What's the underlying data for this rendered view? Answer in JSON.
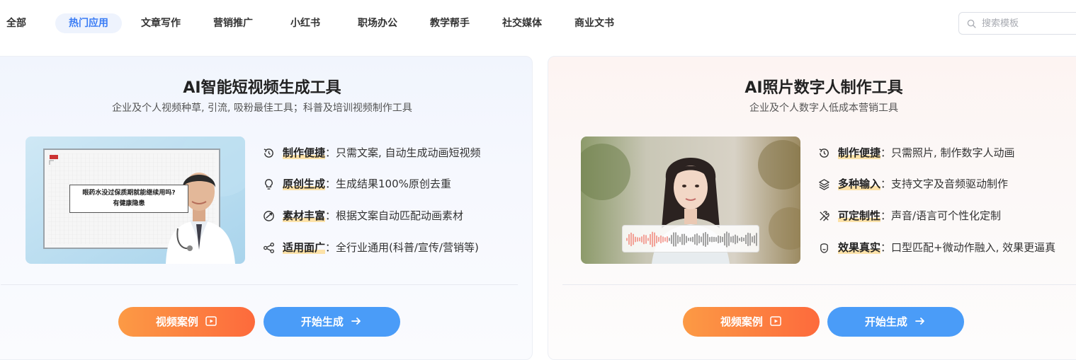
{
  "tabs": [
    {
      "label": "全部",
      "active": false
    },
    {
      "label": "热门应用",
      "active": true
    },
    {
      "label": "文章写作",
      "active": false
    },
    {
      "label": "营销推广",
      "active": false
    },
    {
      "label": "小红书",
      "active": false
    },
    {
      "label": "职场办公",
      "active": false
    },
    {
      "label": "教学帮手",
      "active": false
    },
    {
      "label": "社交媒体",
      "active": false
    },
    {
      "label": "商业文书",
      "active": false
    }
  ],
  "search": {
    "placeholder": "搜索模板",
    "icon": "search-icon"
  },
  "cards": [
    {
      "title": "AI智能短视频生成工具",
      "subtitle": "企业及个人视频种草, 引流, 吸粉最佳工具；科普及培训视频制作工具",
      "thumb": {
        "question_line1": "眼药水没过保质期就能继续用吗?",
        "question_line2": "有健康隐患"
      },
      "features": [
        {
          "icon": "clock-refresh-icon",
          "key": "制作便捷",
          "desc": "：只需文案, 自动生成动画短视频"
        },
        {
          "icon": "lightbulb-icon",
          "key": "原创生成",
          "desc": "：生成结果100%原创去重"
        },
        {
          "icon": "shuffle-icon",
          "key": "素材丰富",
          "desc": "：根据文案自动匹配动画素材"
        },
        {
          "icon": "share-icon",
          "key": "适用面广",
          "desc": "：全行业通用(科普/宣传/营销等)"
        }
      ],
      "buttons": {
        "cases": "视频案例",
        "start": "开始生成"
      }
    },
    {
      "title": "AI照片数字人制作工具",
      "subtitle": "企业及个人数字人低成本营销工具",
      "features": [
        {
          "icon": "clock-refresh-icon",
          "key": "制作便捷",
          "desc": "：只需照片, 制作数字人动画"
        },
        {
          "icon": "layers-icon",
          "key": "多种输入",
          "desc": "：支持文字及音频驱动制作"
        },
        {
          "icon": "tools-icon",
          "key": "可定制性",
          "desc": "：声音/语言可个性化定制"
        },
        {
          "icon": "face-icon",
          "key": "效果真实",
          "desc": "：口型匹配+微动作融入, 效果更逼真"
        }
      ],
      "buttons": {
        "cases": "视频案例",
        "start": "开始生成"
      }
    }
  ],
  "colors": {
    "accent_blue": "#3a7cf5",
    "button_blue": "#4a9cf8",
    "button_orange_start": "#fc9a45",
    "button_orange_end": "#fd6a3c",
    "highlight": "#fde2a8"
  }
}
